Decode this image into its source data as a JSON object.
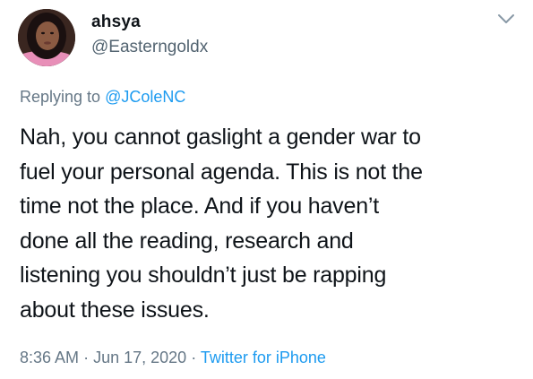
{
  "author": {
    "display_name": "ahsya",
    "handle": "@Easterngoldx"
  },
  "reply": {
    "prefix": "Replying to",
    "mention": "@JColeNC"
  },
  "tweet": {
    "text": "Nah, you cannot gaslight a gender war to\nfuel your personal agenda. This is not the\ntime not the place. And if you haven’t\ndone all the reading, research and\nlistening you shouldn’t just be rapping\nabout these issues."
  },
  "meta": {
    "time": "8:36 AM",
    "separator_1": "·",
    "date": "Jun 17, 2020",
    "separator_2": "·",
    "source": "Twitter for iPhone"
  },
  "icons": {
    "menu": "chevron-down-icon",
    "avatar": "avatar"
  },
  "colors": {
    "text_primary": "#0f1419",
    "text_secondary": "#657786",
    "link": "#1d9bf0",
    "background": "#ffffff"
  }
}
